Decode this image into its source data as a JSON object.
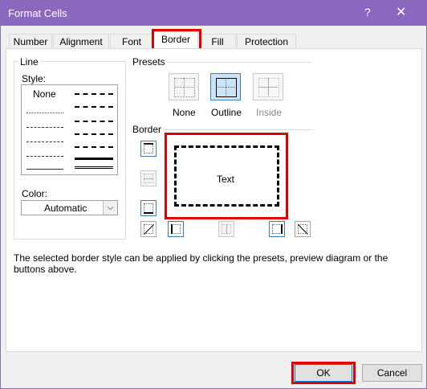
{
  "window": {
    "title": "Format Cells",
    "help": "?",
    "close": "✕"
  },
  "tabs": [
    {
      "label": "Number"
    },
    {
      "label": "Alignment"
    },
    {
      "label": "Font"
    },
    {
      "label": "Border"
    },
    {
      "label": "Fill"
    },
    {
      "label": "Protection"
    }
  ],
  "line": {
    "group_label": "Line",
    "style_label": "Style:",
    "none_label": "None",
    "color_label": "Color:",
    "color_value": "Automatic"
  },
  "presets": {
    "group_label": "Presets",
    "items": [
      {
        "label": "None"
      },
      {
        "label": "Outline"
      },
      {
        "label": "Inside"
      }
    ]
  },
  "border": {
    "group_label": "Border",
    "preview_text": "Text"
  },
  "hint": "The selected border style can be applied by clicking the presets, preview diagram or the buttons above.",
  "buttons": {
    "ok": "OK",
    "cancel": "Cancel"
  },
  "colors": {
    "titlebar": "#8a68c0",
    "highlight": "#e00000",
    "selected_preset": "#cce4f7"
  }
}
